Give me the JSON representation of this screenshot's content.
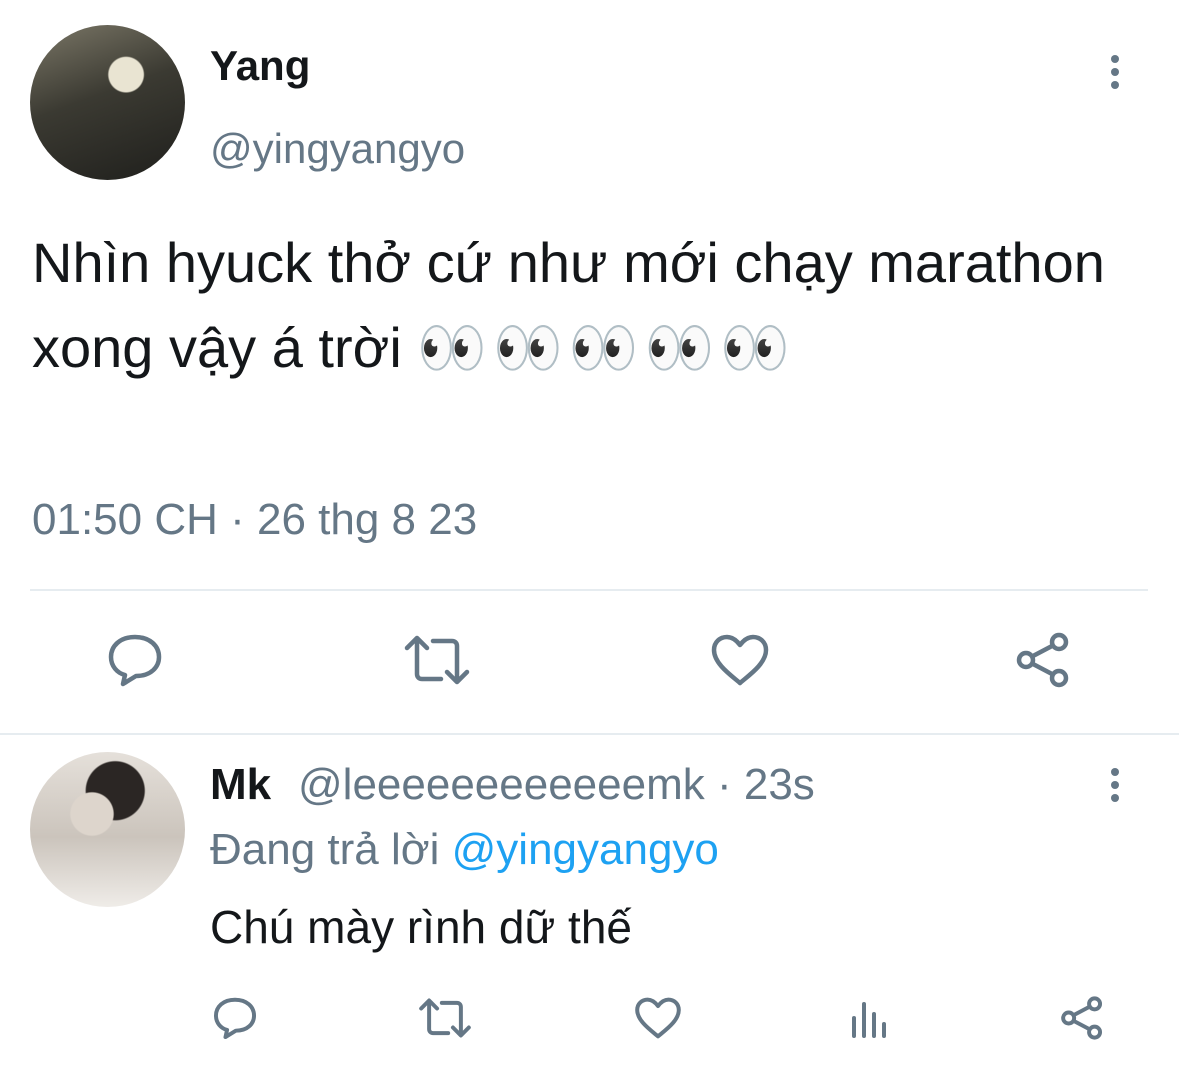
{
  "tweet": {
    "author_name": "Yang",
    "author_handle": "@yingyangyo",
    "text": "Nhìn hyuck thở cứ như mới chạy marathon xong vậy á trời",
    "emoji": "👀👀👀👀👀",
    "timestamp": "01:50 CH · 26 thg 8 23",
    "actions": [
      "reply-icon",
      "retweet-icon",
      "like-icon",
      "share-icon"
    ]
  },
  "reply": {
    "author_name": "Mk",
    "author_handle_time": "@leeeeeeeeeeeemk · 23s",
    "replying_prefix": "Đang trả lời",
    "replying_handle": "@yingyangyo",
    "text": "Chú mày rình dữ thế",
    "actions": [
      "reply-icon",
      "retweet-icon",
      "like-icon",
      "analytics-icon",
      "share-icon"
    ]
  },
  "colors": {
    "text": "#14171a",
    "secondary": "#657786",
    "accent": "#1da1f2",
    "divider": "#e6ecf0"
  }
}
